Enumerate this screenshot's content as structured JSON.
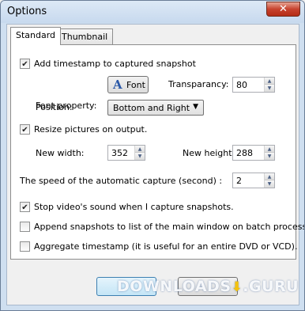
{
  "window": {
    "title": "Options",
    "close_glyph": "✕"
  },
  "tabs": [
    {
      "label": "Standard",
      "active": true
    },
    {
      "label": "Thumbnail",
      "active": false
    }
  ],
  "timestamp": {
    "checkbox_label": "Add timestamp to captured snapshot",
    "checked": true,
    "font_property_label": "Font property:",
    "font_button_label": "Font",
    "font_icon": "font-letter-A-icon",
    "transparency_label": "Transparancy:",
    "transparency_value": "80",
    "position_label": "Position:",
    "position_value": "Bottom and Right"
  },
  "resize": {
    "checkbox_label": "Resize pictures on output.",
    "checked": true,
    "width_label": "New width:",
    "width_value": "352",
    "height_label": "New height:",
    "height_value": "288"
  },
  "capture_speed": {
    "label": "The speed of the automatic capture (second) :",
    "value": "2"
  },
  "options": [
    {
      "label": "Stop video's sound when I capture snapshots.",
      "checked": true
    },
    {
      "label": "Append snapshots to list of the main window on batch processing.",
      "checked": false
    },
    {
      "label": "Aggregate timestamp (it is useful for an entire DVD or VCD).",
      "checked": false
    }
  ],
  "watermark": {
    "text_left": "DOWNLOADS",
    "text_right": ".GURU"
  },
  "colors": {
    "accent": "#2a58a8",
    "titlebar": "#cfdff0",
    "close": "#c7432e"
  }
}
